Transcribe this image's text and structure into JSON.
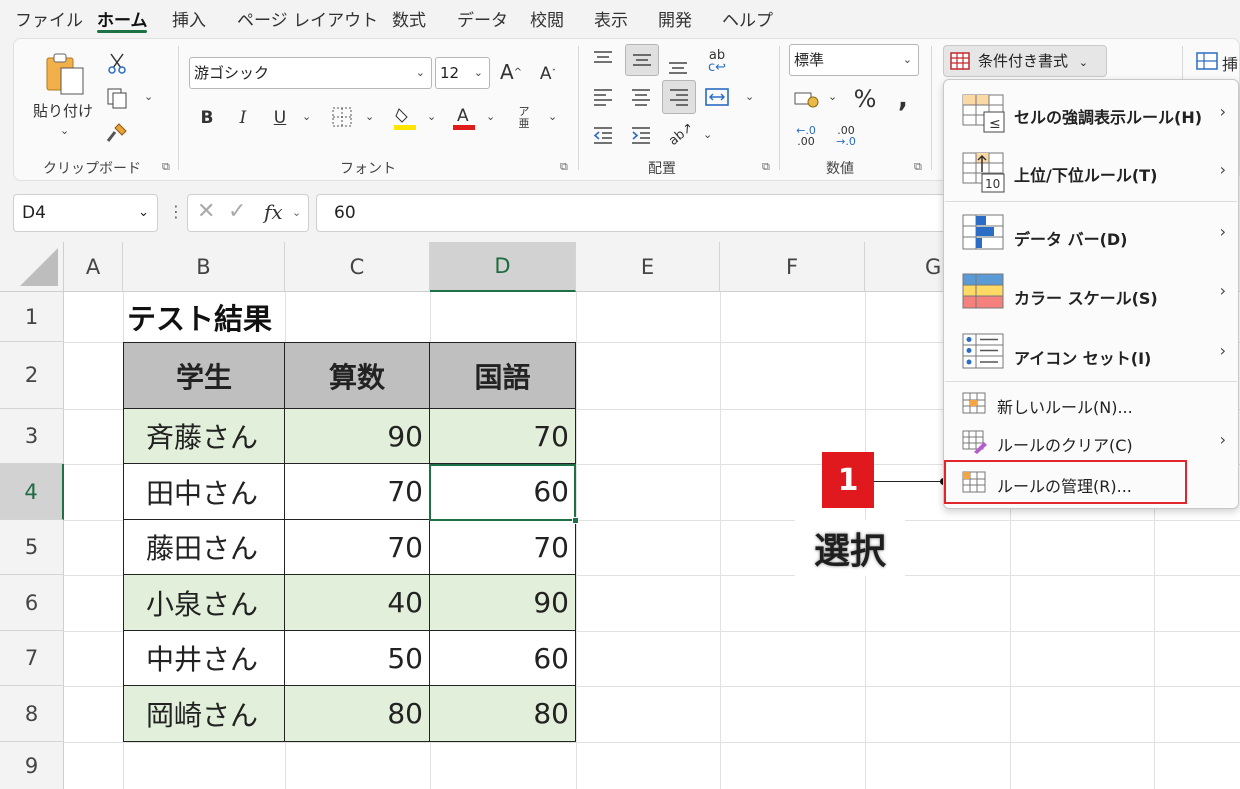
{
  "menu_tabs": [
    "ファイル",
    "ホーム",
    "挿入",
    "ページ レイアウト",
    "数式",
    "データ",
    "校閲",
    "表示",
    "開発",
    "ヘルプ"
  ],
  "ribbon": {
    "clipboard": {
      "paste_label": "貼り付け",
      "group_label": "クリップボード"
    },
    "font": {
      "font_name": "游ゴシック",
      "font_size": "12",
      "group_label": "フォント"
    },
    "alignment": {
      "group_label": "配置"
    },
    "number": {
      "format": "標準",
      "group_label": "数値"
    },
    "styles": {
      "conditional_formatting": "条件付き書式"
    },
    "cells": {
      "insert_label": "挿"
    }
  },
  "formula_bar": {
    "name_box": "D4",
    "formula": "60"
  },
  "sheet": {
    "columns": [
      "A",
      "B",
      "C",
      "D",
      "E",
      "F",
      "G"
    ],
    "rows": [
      "1",
      "2",
      "3",
      "4",
      "5",
      "6",
      "7",
      "8",
      "9"
    ],
    "title": "テスト結果",
    "table_header": [
      "学生",
      "算数",
      "国語"
    ],
    "table_rows": [
      {
        "name": "斉藤さん",
        "math": "90",
        "japanese": "70"
      },
      {
        "name": "田中さん",
        "math": "70",
        "japanese": "60"
      },
      {
        "name": "藤田さん",
        "math": "70",
        "japanese": "70"
      },
      {
        "name": "小泉さん",
        "math": "40",
        "japanese": "90"
      },
      {
        "name": "中井さん",
        "math": "50",
        "japanese": "60"
      },
      {
        "name": "岡崎さん",
        "math": "80",
        "japanese": "80"
      }
    ]
  },
  "cf_menu": {
    "items": [
      "セルの強調表示ルール(H)",
      "上位/下位ルール(T)",
      "データ バー(D)",
      "カラー スケール(S)",
      "アイコン セット(I)",
      "新しいルール(N)...",
      "ルールのクリア(C)",
      "ルールの管理(R)..."
    ]
  },
  "callout": {
    "number": "1",
    "text": "選択"
  },
  "colors": {
    "accent_green": "#1e7145",
    "highlight_red": "#e0262b",
    "row_green": "#e2efda",
    "header_gray": "#bfbfbf"
  }
}
